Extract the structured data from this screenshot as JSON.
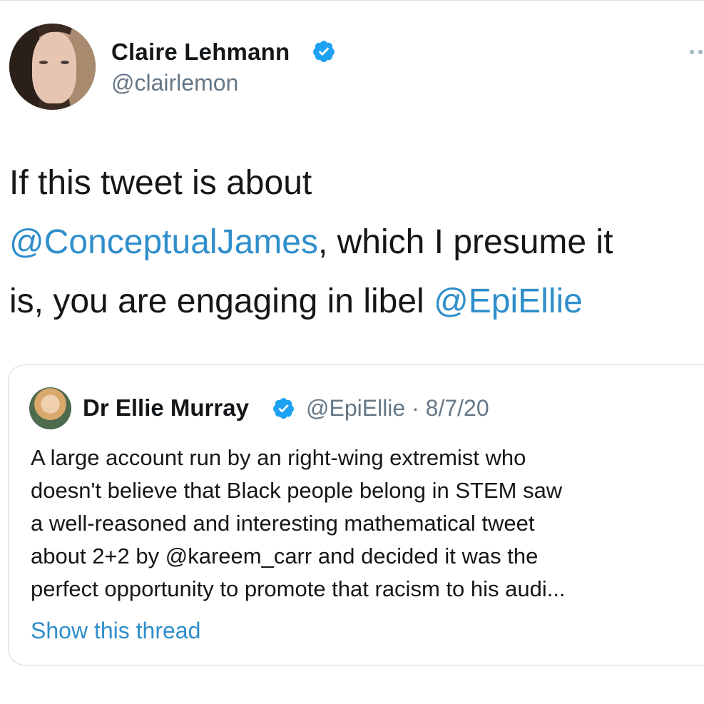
{
  "tweet": {
    "author": {
      "name": "Claire Lehmann",
      "handle": "@clairlemon"
    },
    "text_lines": [
      [
        {
          "text": "If this tweet is about",
          "mention": false
        }
      ],
      [
        {
          "text": "@ConceptualJames",
          "mention": true
        },
        {
          "text": ", which I presume it",
          "mention": false
        }
      ],
      [
        {
          "text": "is, you are engaging in libel ",
          "mention": false
        },
        {
          "text": "@EpiEllie",
          "mention": true
        }
      ]
    ]
  },
  "quote": {
    "author": {
      "name": "Dr Ellie Murray",
      "handle_date": "@EpiEllie · 8/7/20"
    },
    "text_lines": [
      "A large account run by an right-wing extremist who",
      "doesn't believe that Black people belong in STEM saw",
      "a well-reasoned and interesting mathematical tweet",
      "about 2+2 by @kareem_carr and decided it was the",
      "perfect opportunity to promote that racism to his audi..."
    ],
    "show_thread": "Show this thread"
  },
  "icons": {
    "verified": "verified-badge-icon",
    "more": "more-options-icon"
  },
  "colors": {
    "link": "#2f8ecb",
    "verified": "#1da1f2",
    "secondary_text": "#657786"
  }
}
